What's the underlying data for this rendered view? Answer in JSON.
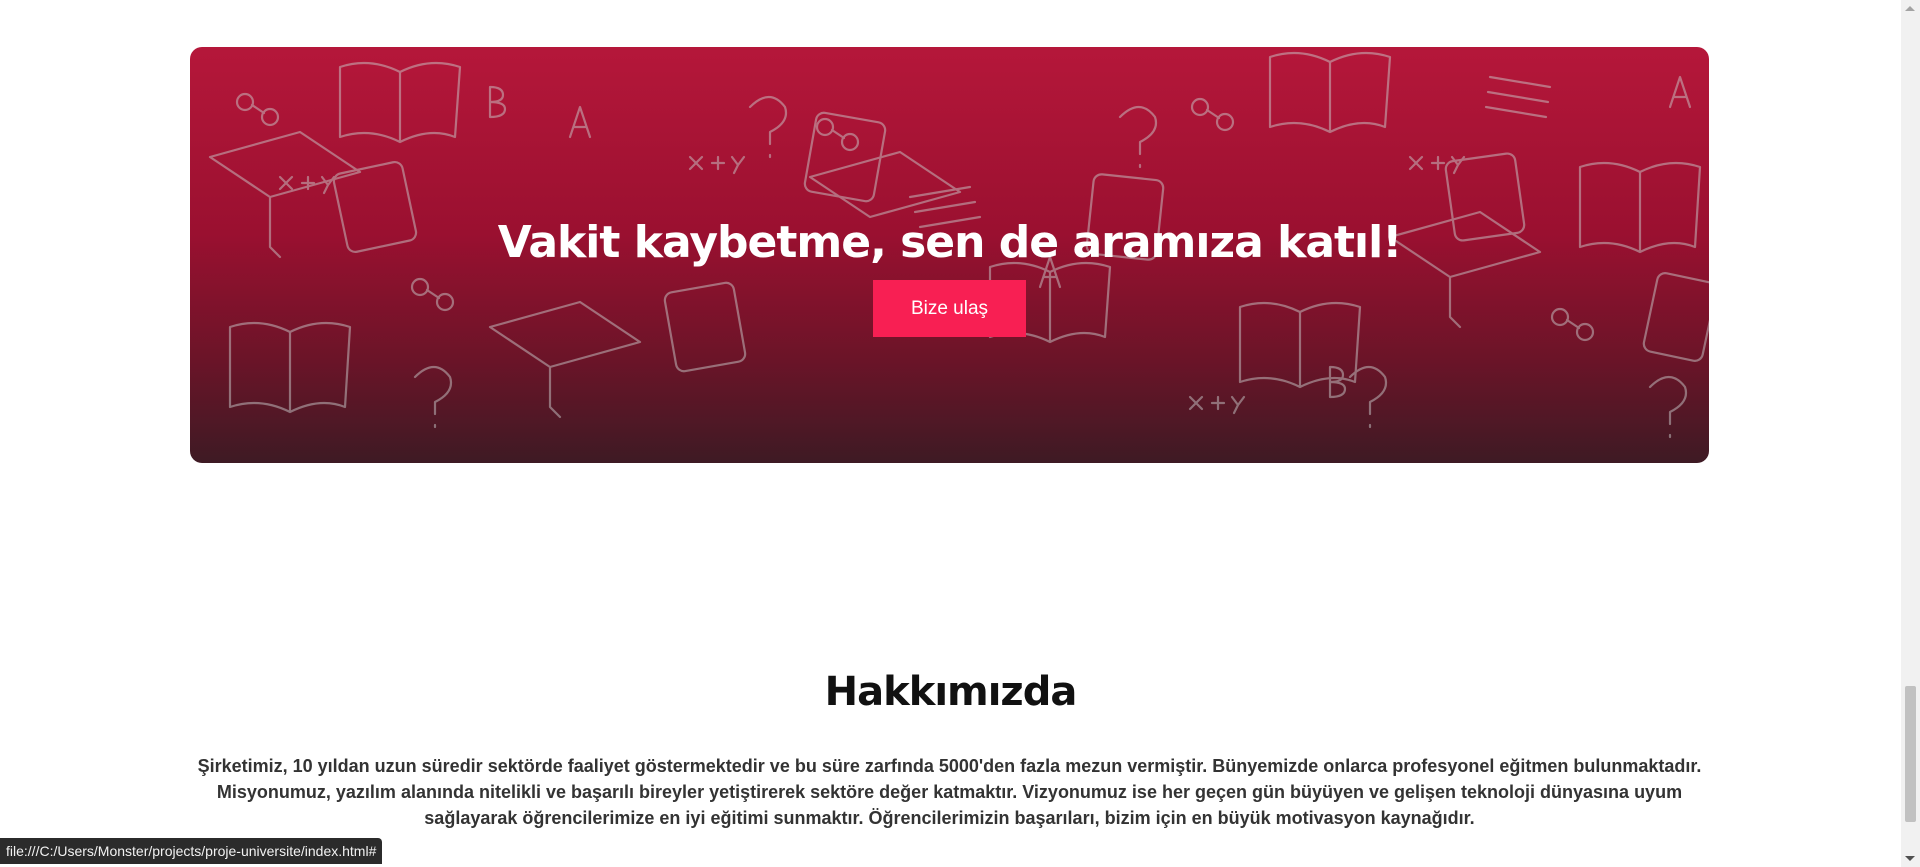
{
  "cta": {
    "title": "Vakit kaybetme, sen de aramıza katıl!",
    "button_label": "Bize ulaş",
    "colors": {
      "gradient_top": "#b5173a",
      "gradient_bottom": "#3e1a24",
      "button": "#f81f53"
    }
  },
  "about": {
    "title": "Hakkımızda",
    "text": "Şirketimiz, 10 yıldan uzun süredir sektörde faaliyet göstermektedir ve bu süre zarfında 5000'den fazla mezun vermiştir. Bünyemizde onlarca profesyonel eğitmen bulunmaktadır. Misyonumuz, yazılım alanında nitelikli ve başarılı bireyler yetiştirerek sektöre değer katmaktır. Vizyonumuz ise her geçen gün büyüyen ve gelişen teknoloji dünyasına uyum sağlayarak öğrencilerimize en iyi eğitimi sunmaktır. Öğrencilerimizin başarıları, bizim için en büyük motivasyon kaynağıdır."
  },
  "status_bar": {
    "url": "file:///C:/Users/Monster/projects/proje-universite/index.html#"
  }
}
